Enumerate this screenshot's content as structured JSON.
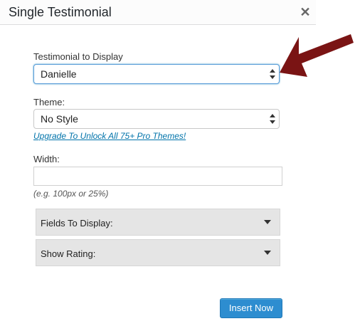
{
  "dialog": {
    "title": "Single Testimonial",
    "close_glyph": "✕"
  },
  "fields": {
    "testimonial_label": "Testimonial to Display",
    "testimonial_value": "Danielle",
    "theme_label": "Theme:",
    "theme_value": "No Style",
    "upgrade_link": "Upgrade To Unlock All 75+ Pro Themes!",
    "width_label": "Width:",
    "width_value": "",
    "width_hint": "(e.g. 100px or 25%)"
  },
  "accordions": {
    "fields_to_display": "Fields To Display:",
    "show_rating": "Show Rating:"
  },
  "actions": {
    "insert_label": "Insert Now"
  },
  "colors": {
    "accent": "#2d8dd0",
    "link": "#0073aa",
    "arrow": "#7a1414"
  },
  "icons": {
    "close": "close-icon",
    "select_arrows": "updown-arrows-icon",
    "accordion_caret": "caret-down-icon",
    "annotation_arrow": "pointer-arrow-icon"
  }
}
